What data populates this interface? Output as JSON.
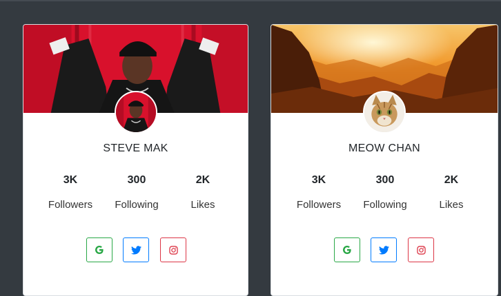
{
  "profiles": [
    {
      "name": "STEVE MAK",
      "stats": [
        {
          "value": "3K",
          "label": "Followers"
        },
        {
          "value": "300",
          "label": "Following"
        },
        {
          "value": "2K",
          "label": "Likes"
        }
      ]
    },
    {
      "name": "MEOW CHAN",
      "stats": [
        {
          "value": "3K",
          "label": "Followers"
        },
        {
          "value": "300",
          "label": "Following"
        },
        {
          "value": "2K",
          "label": "Likes"
        }
      ]
    }
  ],
  "social_icons": [
    "google-icon",
    "twitter-icon",
    "instagram-icon"
  ],
  "colors": {
    "background": "#343a40",
    "google": "#28a745",
    "twitter": "#007bff",
    "instagram": "#dc3545"
  }
}
